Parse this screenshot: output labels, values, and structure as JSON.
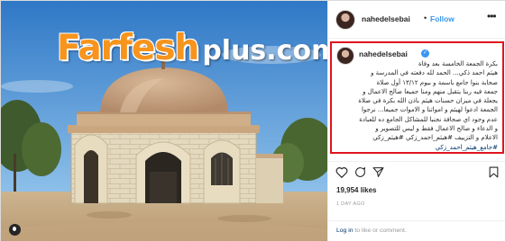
{
  "watermark": {
    "main": "Farfesh",
    "sub": "plus.com"
  },
  "post": {
    "username": "nahedelsebai",
    "follow_label": "Follow",
    "dot": "•",
    "more_label": "•••",
    "verified_mark": "✓",
    "caption_lines": [
      "بكرة الجمعة الخامسة بعد وفاة",
      "هيثم احمد ذكي... الحمد لله دفعته في المدرسة و",
      "صحابة بنوا جامع باسمة و بيوم ١٣/١٢ أول صلاة",
      "جمعة فيه ربنا يتقبل منهم ومنا جميعا صالح الاعمال و",
      "يجعلة في ميزان حسنات هيثم باذن الله بكرة في صلاة",
      "الجمعة ادعوا لهيثم و امواتنا و الاموات جميعا... نرجوا",
      "عدم وجود اي صحافة نجنبا للمشاكل الجامع ده للعبادة",
      "و الدعاء و صالح الاعمال فقط و ليس للتصوير و",
      "الاعلام و التزييف #هيثم_احمد_زكي #هيثم_زكي"
    ],
    "caption_tag_line": "#جامع_هيثم_احمد_زكي",
    "likes": "19,954 likes",
    "date": "1 DAY AGO",
    "login_link": "Log in",
    "login_rest": " to like or comment."
  },
  "icons": {
    "like": "heart-icon",
    "comment": "comment-icon",
    "share": "share-icon",
    "save": "bookmark-icon",
    "instagram": "instagram-icon"
  },
  "colors": {
    "follow": "#3897f0",
    "highlight_border": "#e0141f",
    "watermark": "#f7941d",
    "hashtag": "#003569"
  }
}
